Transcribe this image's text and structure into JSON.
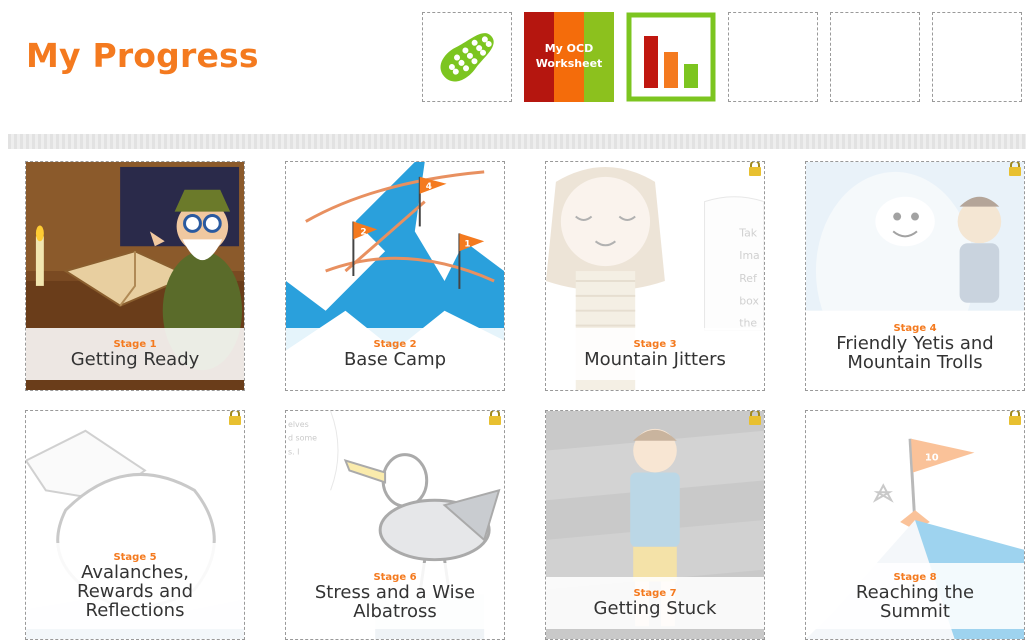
{
  "page": {
    "title": "My Progress"
  },
  "toolbar": {
    "items": [
      {
        "name": "walking-shoe",
        "icon": "shoe-print-icon"
      },
      {
        "name": "my-ocd-worksheet",
        "label_line1": "My OCD",
        "label_line2": "Worksheet",
        "icon": "worksheet-icon"
      },
      {
        "name": "progress-chart",
        "icon": "bar-chart-icon"
      },
      {
        "name": "empty-slot-1"
      },
      {
        "name": "empty-slot-2"
      },
      {
        "name": "empty-slot-3"
      }
    ]
  },
  "stages": [
    {
      "stage_label": "Stage 1",
      "name": "Getting Ready",
      "locked": false
    },
    {
      "stage_label": "Stage 2",
      "name": "Base Camp",
      "locked": false
    },
    {
      "stage_label": "Stage 3",
      "name": "Mountain Jitters",
      "locked": true
    },
    {
      "stage_label": "Stage 4",
      "name": "Friendly Yetis and\nMountain Trolls",
      "locked": true
    },
    {
      "stage_label": "Stage 5",
      "name": "Avalanches,\nRewards and\nReflections",
      "locked": true
    },
    {
      "stage_label": "Stage 6",
      "name": "Stress and a Wise\nAlbatross",
      "locked": true
    },
    {
      "stage_label": "Stage 7",
      "name": "Getting Stuck",
      "locked": true
    },
    {
      "stage_label": "Stage 8",
      "name": "Reaching the\nSummit",
      "locked": true
    }
  ],
  "art_text": {
    "stage2_flags": [
      "2",
      "4",
      "1"
    ],
    "stage3_note": [
      "Tak",
      "Ima",
      "Ref",
      "box",
      "the"
    ],
    "stage6_note": [
      "elves",
      "d some",
      "s. I"
    ],
    "stage8_flag": "10"
  },
  "colors": {
    "accent": "#f47a1f",
    "green": "#7cc520",
    "worksheet_red": "#b5160f",
    "worksheet_orange": "#f46c0b",
    "worksheet_green": "#8cc11e",
    "sky_blue": "#2aa0dc"
  }
}
